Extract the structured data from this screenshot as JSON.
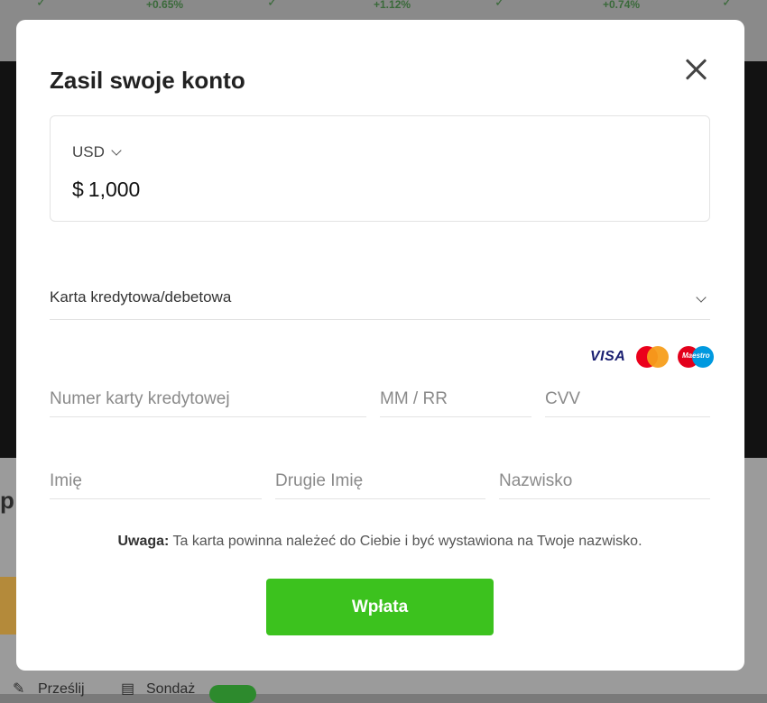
{
  "background": {
    "tickers": [
      "+0.65%",
      "+1.12%",
      "+0.74%"
    ],
    "side_letter": "p",
    "bottom_links": [
      "Prześlij",
      "Sondaż"
    ]
  },
  "modal": {
    "title": "Zasil swoje konto",
    "currency": "USD",
    "currency_symbol": "$",
    "amount": "1,000",
    "payment_method": "Karta kredytowa/debetowa",
    "card_brands": [
      "VISA",
      "Mastercard",
      "Maestro"
    ],
    "card_number_placeholder": "Numer karty kredytowej",
    "expiry_placeholder": "MM / RR",
    "cvv_placeholder": "CVV",
    "first_name_placeholder": "Imię",
    "middle_name_placeholder": "Drugie Imię",
    "last_name_placeholder": "Nazwisko",
    "notice_label": "Uwaga:",
    "notice_text": " Ta karta powinna należeć do Ciebie i być wystawiona na Twoje nazwisko.",
    "submit_label": "Wpłata"
  },
  "colors": {
    "submit": "#3cc21e",
    "visa": "#1a1f71",
    "mastercard_red": "#eb001b",
    "mastercard_orange": "#f79e1b",
    "maestro_blue": "#0099df"
  }
}
